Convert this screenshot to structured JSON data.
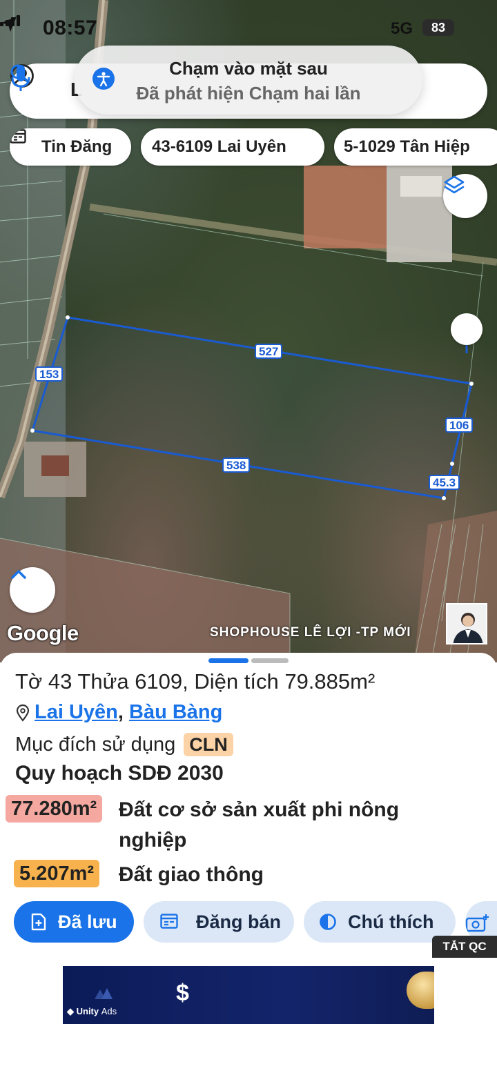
{
  "status_bar": {
    "time": "08:57",
    "network": "5G",
    "battery": "83"
  },
  "search": {
    "value": "L"
  },
  "toast": {
    "title": "Chạm vào mặt sau",
    "subtitle": "Đã phát hiện Chạm hai lần"
  },
  "chips": [
    {
      "label": "Tin Đăng"
    },
    {
      "label": "43-6109 Lai Uyên"
    },
    {
      "label": "5-1029 Tân Hiệp"
    }
  ],
  "map": {
    "dimensions": [
      "527",
      "153",
      "106",
      "538",
      "45.3"
    ],
    "google_logo": "Google",
    "watermark": "SHOPHOUSE LÊ LỢI -TP MỚI",
    "boundary_color": "#1a5bd1"
  },
  "sheet": {
    "title": "Tờ 43 Thửa 6109, Diện tích 79.885m²",
    "location": {
      "ward": "Lai Uyên",
      "separator": ",",
      "district": "Bàu Bàng"
    },
    "purpose_label": "Mục đích sử dụng",
    "purpose_code": "CLN",
    "plan_title": "Quy hoạch SDĐ 2030",
    "plan_items": [
      {
        "area": "77.280m²",
        "description": "Đất cơ sở sản xuất phi nông nghiệp",
        "color": "#f4a8a0"
      },
      {
        "area": "5.207m²",
        "description": "Đất giao thông",
        "color": "#f7b24d"
      }
    ],
    "actions": {
      "save": "Đã lưu",
      "post": "Đăng bán",
      "legend": "Chú thích"
    },
    "ad_tag": "TẮT QC",
    "ad": {
      "symbol": "$",
      "brand": "Unity",
      "brand_suffix": "Ads"
    }
  }
}
